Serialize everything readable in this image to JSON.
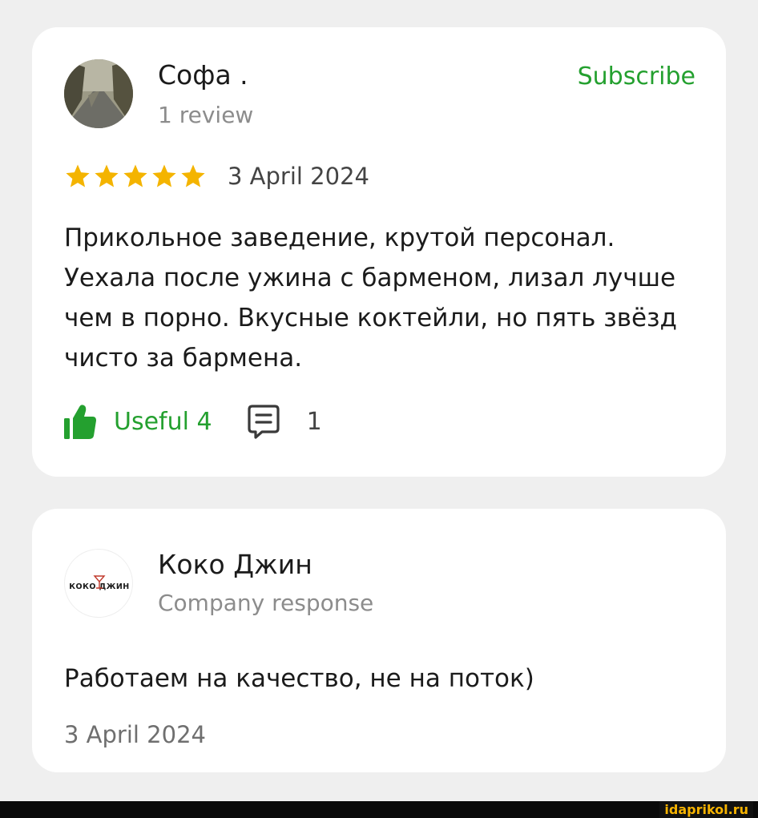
{
  "review": {
    "author_name": "Софа .",
    "author_sub": "1 review",
    "subscribe_label": "Subscribe",
    "rating": 5,
    "date": "3 April 2024",
    "text": "Прикольное заведение, крутой персонал. Уехала после ужина с барменом, лизал лучше чем в порно. Вкусные коктейли, но пять звёзд чисто за бармена.",
    "useful_label": "Useful 4",
    "comments_count": "1"
  },
  "response": {
    "company_name": "Коко Джин",
    "company_sub": "Company response",
    "logo_text": "КОКО ДЖИН",
    "text": "Работаем на качество, не на поток)",
    "date": "3 April 2024"
  },
  "watermark": "idaprikol.ru",
  "colors": {
    "accent_green": "#24a02f",
    "star_gold": "#f4b400",
    "background": "#efefef",
    "card": "#ffffff"
  },
  "icons": {
    "avatar": "avatar-photo",
    "star": "star-icon",
    "useful": "thumbs-up-icon",
    "comments": "comment-icon",
    "logo": "company-logo"
  }
}
